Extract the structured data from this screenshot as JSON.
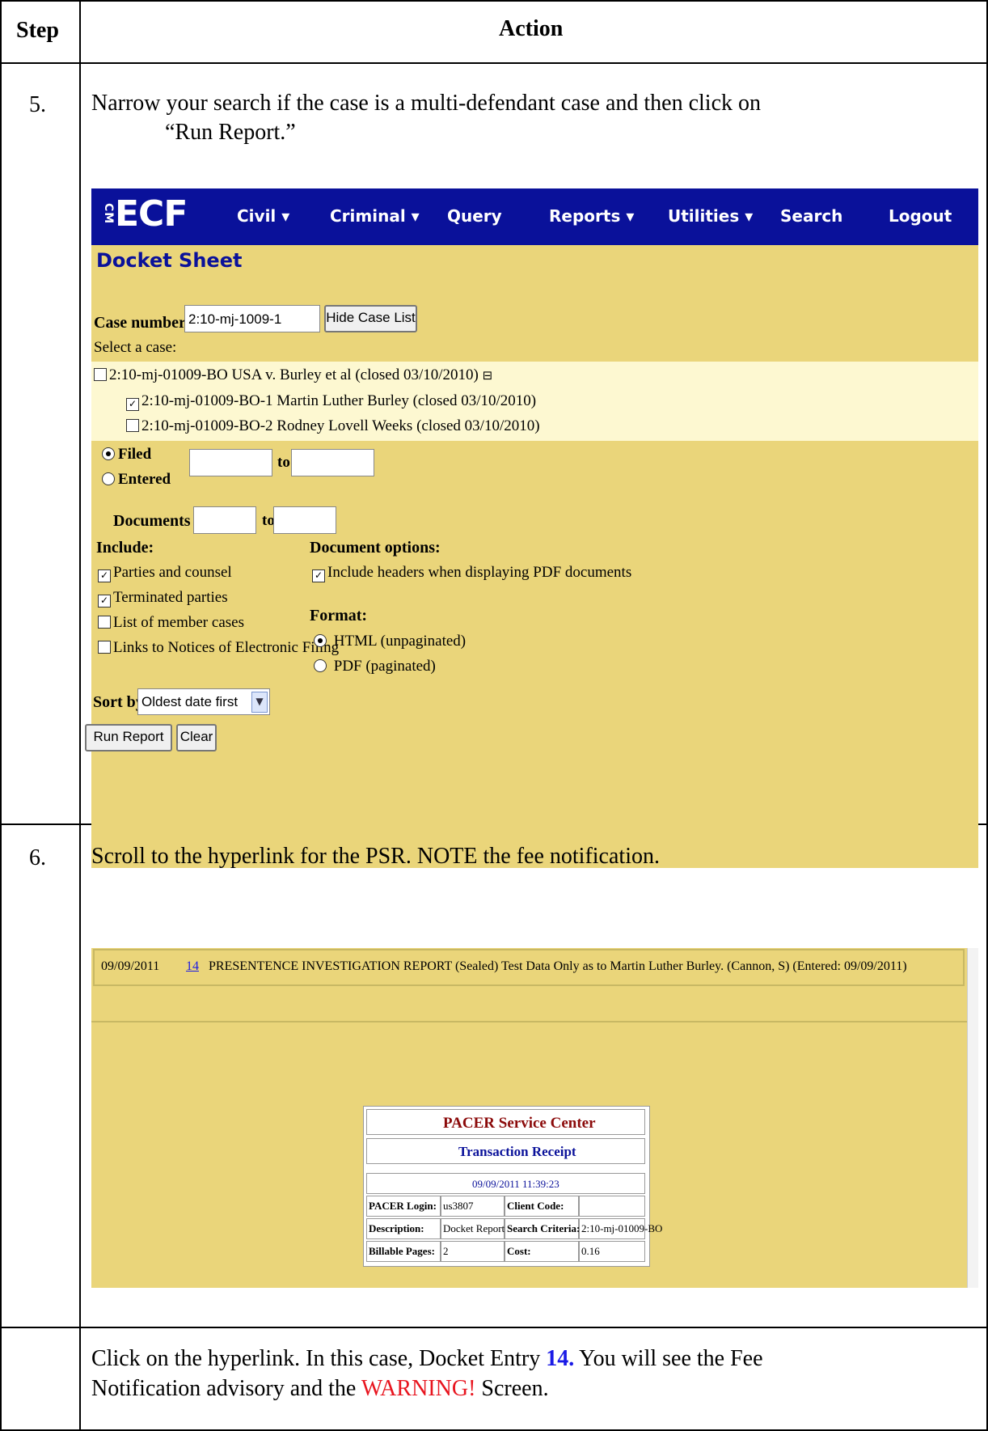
{
  "table": {
    "header_step": "Step",
    "header_action": "Action",
    "rows": [
      {
        "step": "5.",
        "text_line1": "Narrow your search if the case is a multi-defendant case and then click on",
        "text_line2": "“Run Report.”"
      },
      {
        "step": "6.",
        "text_line1": "Scroll to the hyperlink for the PSR. NOTE the fee notification."
      },
      {
        "step": "",
        "text_part1": "Click on the hyperlink.   In this case, Docket Entry ",
        "text_link": "14.",
        "text_part2": " You will see the Fee",
        "text_line2_part1": "Notification advisory and the ",
        "text_warning": "WARNING!",
        "text_line2_part2": " Screen."
      }
    ]
  },
  "ecf": {
    "logo": "ECF",
    "logo_small": "CM",
    "nav": [
      "Civil ▾",
      "Criminal ▾",
      "Query",
      "Reports ▾",
      "Utilities ▾",
      "Search",
      "Logout"
    ],
    "title": "Docket Sheet",
    "case_number_label": "Case number",
    "case_number_value": "2:10-mj-1009-1",
    "hide_case_list": "Hide Case List",
    "select_case_label": "Select a case:",
    "cases": [
      {
        "label": "2:10-mj-01009-BO USA v. Burley et al (closed 03/10/2010)",
        "checked": false
      },
      {
        "label": "2:10-mj-01009-BO-1 Martin Luther Burley (closed 03/10/2010)",
        "checked": true
      },
      {
        "label": "2:10-mj-01009-BO-2 Rodney Lovell Weeks (closed 03/10/2010)",
        "checked": false
      }
    ],
    "collapse_icon": "⊟",
    "filed_label": "Filed",
    "entered_label": "Entered",
    "to_label": "to",
    "documents_label": "Documents",
    "include_label": "Include:",
    "include": [
      {
        "label": "Parties and counsel",
        "checked": true
      },
      {
        "label": "Terminated parties",
        "checked": true
      },
      {
        "label": "List of member cases",
        "checked": false
      },
      {
        "label": "Links to Notices of Electronic Filing",
        "checked": false
      }
    ],
    "doc_options_label": "Document options:",
    "doc_option": {
      "label": "Include headers when displaying PDF documents",
      "checked": true
    },
    "format_label": "Format:",
    "formats": [
      {
        "label": "HTML (unpaginated)",
        "selected": true
      },
      {
        "label": "PDF (paginated)",
        "selected": false
      }
    ],
    "sort_label": "Sort by",
    "sort_value": "Oldest date first",
    "run_report": "Run Report",
    "clear": "Clear"
  },
  "docket_entry": {
    "date": "09/09/2011",
    "number": "14",
    "text": "PRESENTENCE INVESTIGATION REPORT (Sealed) Test Data Only as to Martin Luther Burley. (Cannon, S) (Entered: 09/09/2011)"
  },
  "receipt": {
    "title": "PACER Service Center",
    "subtitle": "Transaction Receipt",
    "timestamp": "09/09/2011 11:39:23",
    "login_label": "PACER Login:",
    "login_value": "us3807",
    "client_label": "Client Code:",
    "client_value": "",
    "desc_label": "Description:",
    "desc_value": "Docket Report",
    "criteria_label": "Search Criteria:",
    "criteria_value": "2:10-mj-01009-BO",
    "pages_label": "Billable Pages:",
    "pages_value": "2",
    "cost_label": "Cost:",
    "cost_value": "0.16"
  },
  "colors": {
    "ecf_nav": "#0a119a",
    "ecf_bg": "#ead57a",
    "link": "#1a1ae6",
    "warning": "#e8141e",
    "receipt_title": "#8b0a0a",
    "receipt_subtitle": "#0a119a"
  }
}
